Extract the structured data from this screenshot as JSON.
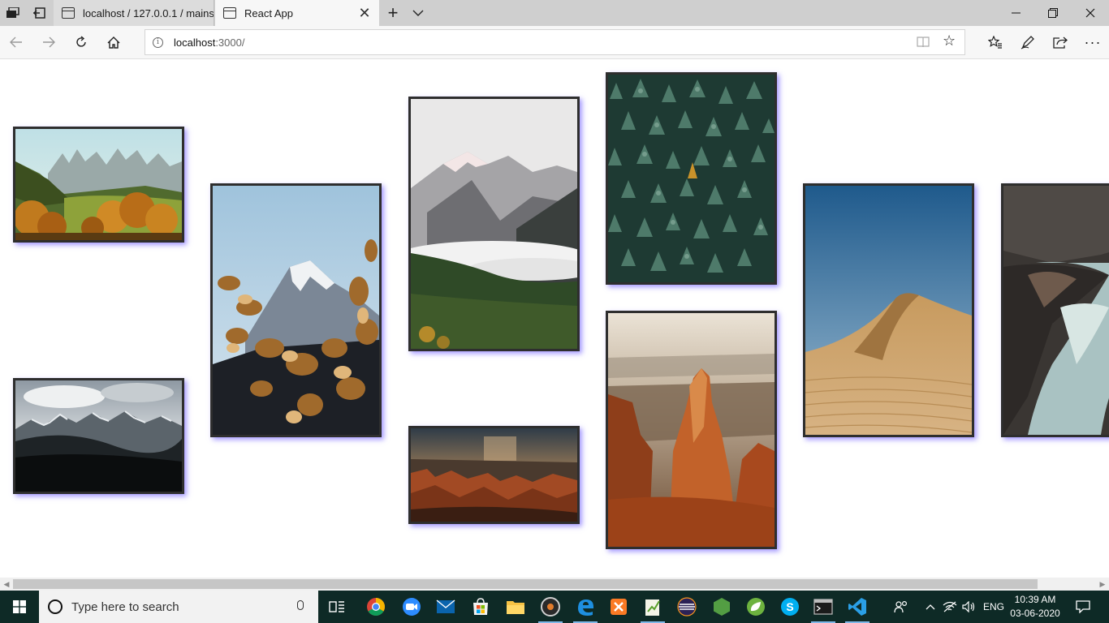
{
  "browser": {
    "tabs": [
      {
        "title": "localhost / 127.0.0.1 / mains",
        "active": false
      },
      {
        "title": "React App",
        "active": true
      }
    ],
    "address": {
      "host": "localhost",
      "path": ":3000/"
    }
  },
  "gallery": {
    "photos": [
      {
        "alt": "autumn-alpine-valley"
      },
      {
        "alt": "snow-peak-with-autumn-leaves"
      },
      {
        "alt": "misty-mountain-forest"
      },
      {
        "alt": "pine-forest-aerial"
      },
      {
        "alt": "desert-sand-dune"
      },
      {
        "alt": "rocky-river-gorge"
      },
      {
        "alt": "dark-mountain-range"
      },
      {
        "alt": "canyon-storm-sunset"
      },
      {
        "alt": "red-rock-hoodoo-canyon"
      }
    ]
  },
  "taskbar": {
    "search_placeholder": "Type here to search",
    "apps": [
      "task-view",
      "chrome",
      "zoom",
      "mail",
      "store",
      "file-explorer",
      "media-player",
      "edge",
      "xampp",
      "notepad-plus-plus",
      "eclipse",
      "nodejs",
      "spring-tools",
      "skype",
      "terminal",
      "vscode"
    ],
    "language": "ENG",
    "time": "10:39 AM",
    "date": "03-06-2020"
  },
  "colors": {
    "frame_border": "#2e2e2e",
    "frame_shadow": "#5a46ff",
    "taskbar": "#0e2a26"
  }
}
